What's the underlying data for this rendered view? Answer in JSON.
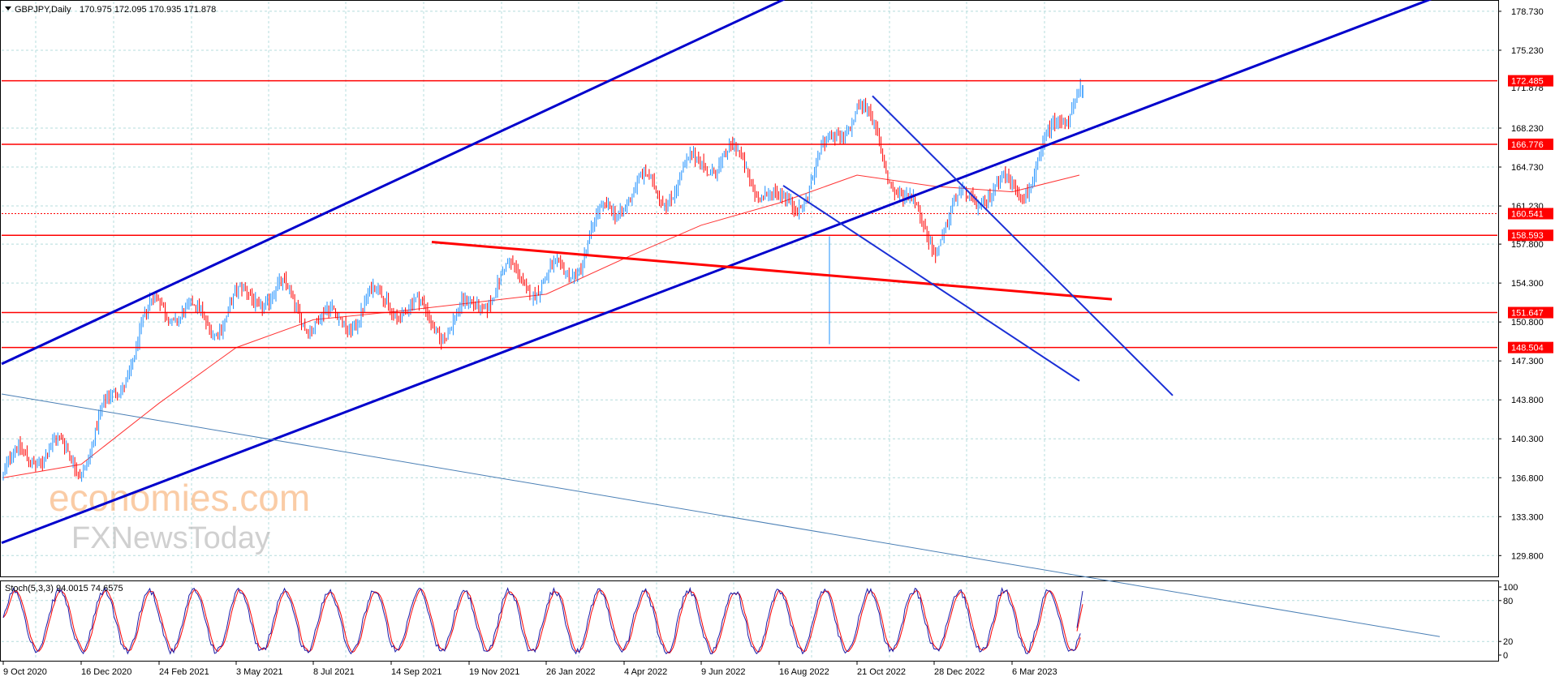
{
  "header": {
    "symbol": "GBPJPY,Daily",
    "ohlc": "170.975 172.095 170.935 171.878",
    "indicator": "Stoch(5,3,3) 94.0015 74.6575"
  },
  "colors": {
    "grid": "#b4dcdc",
    "bull": "#1e90ff",
    "bear": "#ff0000",
    "channel": "#0000cc",
    "level": "#ff0000",
    "ma": "#ff3333",
    "watermark": "#c8c8c8",
    "watermark_accent": "#f5a25c"
  },
  "watermark": {
    "line1": "economies.com",
    "line2": "FXNewsToday"
  },
  "price_axis": {
    "ticks": [
      "178.730",
      "175.230",
      "168.230",
      "164.730",
      "161.230",
      "157.800",
      "154.300",
      "150.800",
      "147.300",
      "143.800",
      "140.300",
      "136.800",
      "133.300",
      "129.800"
    ]
  },
  "current_price": "171.878",
  "levels": [
    {
      "label": "172.485",
      "value": 172.485,
      "style": "solid"
    },
    {
      "label": "166.776",
      "value": 166.776,
      "style": "solid"
    },
    {
      "label": "160.541",
      "value": 160.541,
      "style": "dotted"
    },
    {
      "label": "158.593",
      "value": 158.593,
      "style": "solid"
    },
    {
      "label": "151.647",
      "value": 151.647,
      "style": "solid"
    },
    {
      "label": "148.504",
      "value": 148.504,
      "style": "solid"
    }
  ],
  "stoch_axis": {
    "ticks": [
      "100",
      "80",
      "20",
      "0"
    ]
  },
  "time_axis": {
    "labels": [
      "9 Oct 2020",
      "16 Dec 2020",
      "24 Feb 2021",
      "3 May 2021",
      "8 Jul 2021",
      "14 Sep 2021",
      "19 Nov 2021",
      "26 Jan 2022",
      "4 Apr 2022",
      "9 Jun 2022",
      "16 Aug 2022",
      "21 Oct 2022",
      "28 Dec 2022",
      "6 Mar 2023"
    ]
  },
  "chart_data": {
    "type": "candlestick",
    "symbol": "GBPJPY",
    "timeframe": "Daily",
    "last_bar": {
      "open": 170.975,
      "high": 172.095,
      "low": 170.935,
      "close": 171.878
    },
    "ylim": [
      128.0,
      179.6
    ],
    "key_closes": [
      {
        "date": "9 Oct 2020",
        "close": 137.0
      },
      {
        "date": "16 Dec 2020",
        "close": 139.5
      },
      {
        "date": "24 Feb 2021",
        "close": 151.5
      },
      {
        "date": "3 May 2021",
        "close": 152.5
      },
      {
        "date": "8 Jul 2021",
        "close": 152.0
      },
      {
        "date": "14 Sep 2021",
        "close": 151.5
      },
      {
        "date": "19 Nov 2021",
        "close": 152.0
      },
      {
        "date": "26 Jan 2022",
        "close": 155.0
      },
      {
        "date": "4 Apr 2022",
        "close": 161.0
      },
      {
        "date": "9 Jun 2022",
        "close": 166.0
      },
      {
        "date": "16 Aug 2022",
        "close": 161.5
      },
      {
        "date": "21 Oct 2022",
        "close": 169.0
      },
      {
        "date": "28 Dec 2022",
        "close": 159.0
      },
      {
        "date": "6 Mar 2023",
        "close": 163.0
      }
    ],
    "moving_average_points": [
      {
        "date": "9 Oct 2020",
        "value": 136.8
      },
      {
        "date": "16 Dec 2020",
        "value": 138.0
      },
      {
        "date": "24 Feb 2021",
        "value": 143.5
      },
      {
        "date": "3 May 2021",
        "value": 148.5
      },
      {
        "date": "8 Jul 2021",
        "value": 151.0
      },
      {
        "date": "14 Sep 2021",
        "value": 151.7
      },
      {
        "date": "19 Nov 2021",
        "value": 152.5
      },
      {
        "date": "26 Jan 2022",
        "value": 153.3
      },
      {
        "date": "4 Apr 2022",
        "value": 156.5
      },
      {
        "date": "9 Jun 2022",
        "value": 159.5
      },
      {
        "date": "16 Aug 2022",
        "value": 161.5
      },
      {
        "date": "21 Oct 2022",
        "value": 164.0
      },
      {
        "date": "28 Dec 2022",
        "value": 163.0
      },
      {
        "date": "6 Mar 2023",
        "value": 162.5
      }
    ],
    "trendlines": [
      {
        "name": "channel-upper",
        "from": {
          "date": "9 Oct 2020",
          "price": 147.1
        },
        "to": {
          "date": "16 Aug 2022",
          "price": 179.6
        }
      },
      {
        "name": "channel-lower",
        "from": {
          "date": "9 Oct 2020",
          "price": 131.0
        },
        "to": {
          "date": "6 Mar 2023",
          "price": 165.5
        }
      },
      {
        "name": "red-descending",
        "from": {
          "date": "14 Sep 2021",
          "price": 158.3
        },
        "to": {
          "date": "6 Mar 2023",
          "price": 153.6
        }
      },
      {
        "name": "blue-descending-1",
        "from": {
          "date": "21 Oct 2022",
          "price": 172.5
        },
        "to": {
          "date": "6 Mar 2023",
          "price": 158.6
        }
      },
      {
        "name": "blue-descending-2",
        "from": {
          "date": "16 Aug 2022",
          "price": 163.3
        },
        "to": {
          "date": "6 Mar 2023",
          "price": 149.5
        }
      },
      {
        "name": "long-thin",
        "from": {
          "date": "9 Oct 2020",
          "price": 144.3
        },
        "to": {
          "date": "6 Mar 2023",
          "price": 129.0
        }
      }
    ],
    "stochastic": {
      "label": "Stoch(5,3,3)",
      "main": 94.0015,
      "signal": 74.6575,
      "levels": [
        80,
        20
      ],
      "ylim": [
        0,
        100
      ]
    }
  }
}
